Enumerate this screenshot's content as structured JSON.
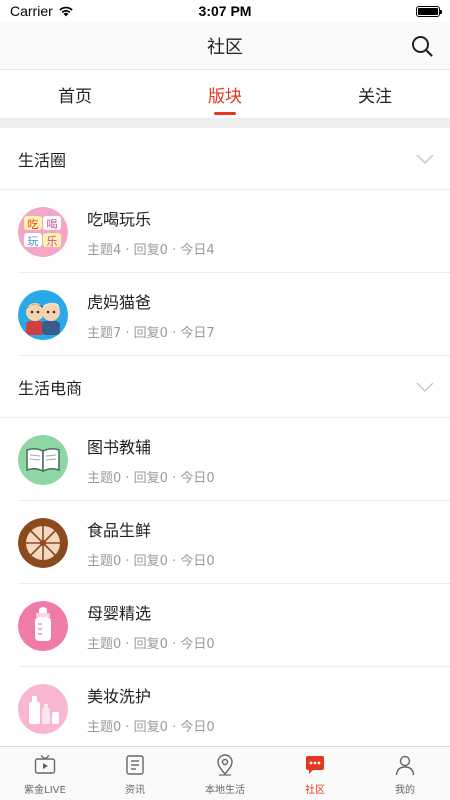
{
  "status_bar": {
    "carrier": "Carrier",
    "time": "3:07 PM"
  },
  "nav": {
    "title": "社区",
    "search_icon": "search-icon"
  },
  "tabs": [
    {
      "label": "首页",
      "active": false
    },
    {
      "label": "版块",
      "active": true
    },
    {
      "label": "关注",
      "active": false
    }
  ],
  "sections": [
    {
      "title": "生活圈",
      "forums": [
        {
          "name": "吃喝玩乐",
          "stats": "主题4 · 回复0 · 今日4",
          "icon": "food-fun-icon"
        },
        {
          "name": "虎妈猫爸",
          "stats": "主题7 · 回复0 · 今日7",
          "icon": "parents-icon"
        }
      ]
    },
    {
      "title": "生活电商",
      "forums": [
        {
          "name": "图书教辅",
          "stats": "主题0 · 回复0 · 今日0",
          "icon": "book-icon"
        },
        {
          "name": "食品生鲜",
          "stats": "主题0 · 回复0 · 今日0",
          "icon": "fruit-slice-icon"
        },
        {
          "name": "母婴精选",
          "stats": "主题0 · 回复0 · 今日0",
          "icon": "baby-bottle-icon"
        },
        {
          "name": "美妆洗护",
          "stats": "主题0 · 回复0 · 今日0",
          "icon": "cosmetics-icon"
        }
      ]
    }
  ],
  "tab_bar": [
    {
      "label": "紫金LIVE",
      "icon": "tv-icon",
      "active": false
    },
    {
      "label": "资讯",
      "icon": "news-list-icon",
      "active": false
    },
    {
      "label": "本地生活",
      "icon": "location-pin-icon",
      "active": false
    },
    {
      "label": "社区",
      "icon": "chat-bubble-icon",
      "active": true
    },
    {
      "label": "我的",
      "icon": "person-icon",
      "active": false
    }
  ],
  "colors": {
    "accent": "#e4371f",
    "divider": "#ececec",
    "muted_text": "#9a9a9a"
  }
}
